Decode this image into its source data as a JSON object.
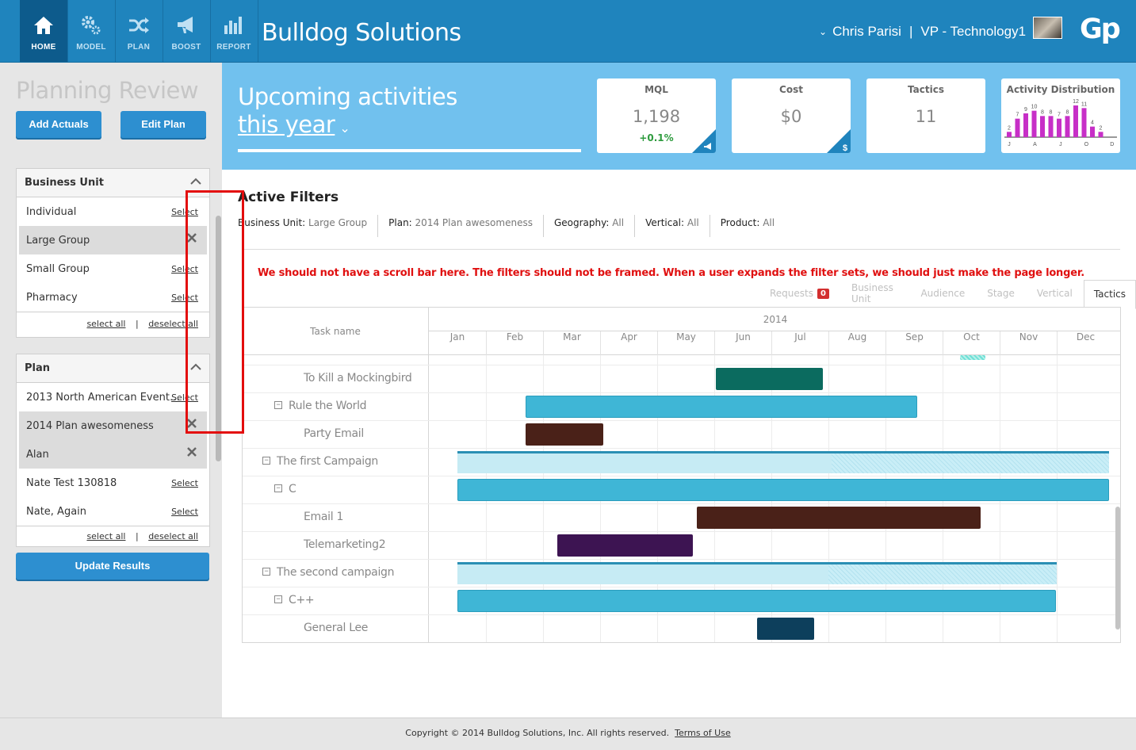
{
  "nav": [
    {
      "label": "HOME",
      "icon": "home-icon",
      "active": true
    },
    {
      "label": "MODEL",
      "icon": "gears-icon",
      "active": false
    },
    {
      "label": "PLAN",
      "icon": "shuffle-icon",
      "active": false
    },
    {
      "label": "BOOST",
      "icon": "megaphone-icon",
      "active": false
    },
    {
      "label": "REPORT",
      "icon": "bar-chart-icon",
      "active": false
    }
  ],
  "brand": "Bulldog Solutions",
  "user": {
    "name": "Chris Parisi",
    "separator": "|",
    "role": "VP - Technology1"
  },
  "logo": "Gp",
  "sidebar": {
    "title": "Planning Review",
    "add_actuals": "Add Actuals",
    "edit_plan": "Edit Plan",
    "business_unit": {
      "title": "Business Unit",
      "items": [
        {
          "label": "Individual",
          "action": "Select",
          "selected": false
        },
        {
          "label": "Large Group",
          "action": "",
          "selected": true
        },
        {
          "label": "Small Group",
          "action": "Select",
          "selected": false
        },
        {
          "label": "Pharmacy",
          "action": "Select",
          "selected": false
        }
      ],
      "select_all": "select all",
      "separator": "|",
      "deselect_all": "deselect all"
    },
    "plan": {
      "title": "Plan",
      "items": [
        {
          "label": "2013 North American Event…",
          "action": "Select",
          "selected": false
        },
        {
          "label": "2014 Plan awesomeness",
          "action": "",
          "selected": true
        },
        {
          "label": "Alan",
          "action": "",
          "selected": true
        },
        {
          "label": "Nate Test 130818",
          "action": "Select",
          "selected": false
        },
        {
          "label": "Nate, Again",
          "action": "Select",
          "selected": false
        }
      ],
      "select_all": "select all",
      "separator": "|",
      "deselect_all": "deselect all"
    },
    "update": "Update Results"
  },
  "header": {
    "title_line1": "Upcoming activities",
    "title_line2": "this year",
    "cards": [
      {
        "title": "MQL",
        "value": "1,198",
        "change": "+0.1%",
        "corner": "megaphone-icon"
      },
      {
        "title": "Cost",
        "value": "$0",
        "change": "",
        "corner": "$"
      },
      {
        "title": "Tactics",
        "value": "11",
        "change": ""
      }
    ],
    "activity": {
      "title": "Activity Distribution",
      "months": [
        "J",
        "A",
        "J",
        "O",
        "D"
      ],
      "values": [
        2,
        7,
        9,
        10,
        8,
        8,
        7,
        8,
        12,
        11,
        4,
        2
      ],
      "bar_color": "#c72fc7"
    }
  },
  "filters": {
    "title": "Active Filters",
    "items": [
      {
        "label": "Business Unit:",
        "value": "Large Group"
      },
      {
        "label": "Plan:",
        "value": "2014 Plan awesomeness"
      },
      {
        "label": "Geography:",
        "value": "All"
      },
      {
        "label": "Vertical:",
        "value": "All"
      },
      {
        "label": "Product:",
        "value": "All"
      }
    ]
  },
  "annotation": "We should not have a scroll bar here. The filters should not be framed. When a user expands the filter sets, we should just make the page longer.",
  "tabs": [
    {
      "label": "Requests",
      "badge": "0",
      "active": false
    },
    {
      "label": "Business Unit",
      "active": false
    },
    {
      "label": "Audience",
      "active": false
    },
    {
      "label": "Stage",
      "active": false
    },
    {
      "label": "Vertical",
      "active": false
    },
    {
      "label": "Tactics",
      "active": true
    }
  ],
  "gantt": {
    "task_header": "Task name",
    "year": "2014",
    "months": [
      "Jan",
      "Feb",
      "Mar",
      "Apr",
      "May",
      "Jun",
      "Jul",
      "Aug",
      "Sep",
      "Oct",
      "Nov",
      "Dec"
    ],
    "tasks": [
      {
        "name": "To Kill a Mockingbird",
        "level": 2,
        "toggle": "",
        "start": 5.03,
        "end": 6.9,
        "color": "#0b6b5f",
        "type": "task"
      },
      {
        "name": "Rule the World",
        "level": 1,
        "toggle": "−",
        "start": 1.7,
        "end": 8.55,
        "color": "#3fb6d6",
        "type": "task"
      },
      {
        "name": "Party Email",
        "level": 2,
        "toggle": "",
        "start": 1.7,
        "end": 3.05,
        "color": "#4a2118",
        "type": "task"
      },
      {
        "name": "The first Campaign",
        "level": 0,
        "toggle": "−",
        "start": 0.5,
        "end": 12.0,
        "progress_end": 7.05,
        "color": "#c6ebf4",
        "type": "summary"
      },
      {
        "name": "C",
        "level": 1,
        "toggle": "−",
        "start": 0.5,
        "end": 12.0,
        "color": "#3fb6d6",
        "type": "task"
      },
      {
        "name": "Email 1",
        "level": 2,
        "toggle": "",
        "start": 4.7,
        "end": 9.67,
        "color": "#4a2118",
        "type": "task"
      },
      {
        "name": "Telemarketing2",
        "level": 2,
        "toggle": "",
        "start": 2.25,
        "end": 4.63,
        "color": "#3d1452",
        "type": "task"
      },
      {
        "name": "The second campaign",
        "level": 0,
        "toggle": "−",
        "start": 0.5,
        "end": 11.0,
        "progress_end": 7.0,
        "color": "#c6ebf4",
        "type": "summary"
      },
      {
        "name": "C++",
        "level": 1,
        "toggle": "−",
        "start": 0.5,
        "end": 10.98,
        "color": "#3fb6d6",
        "type": "task"
      },
      {
        "name": "General Lee",
        "level": 2,
        "toggle": "",
        "start": 5.75,
        "end": 6.75,
        "color": "#0d3f5c",
        "type": "task"
      }
    ]
  },
  "footer": {
    "copyright": "Copyright © 2014 Bulldog Solutions, Inc. All rights reserved.",
    "terms": "Terms of Use"
  }
}
